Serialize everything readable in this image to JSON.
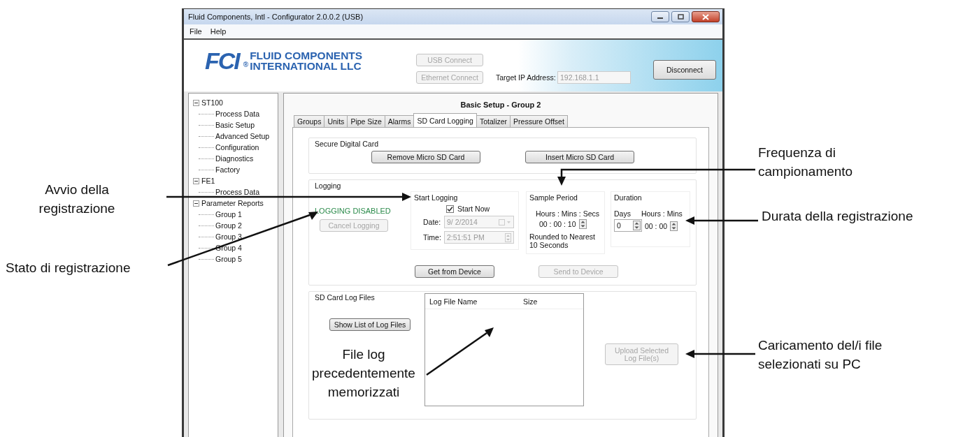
{
  "window": {
    "title": "Fluid Components, Intl - Configurator 2.0.0.2 (USB)"
  },
  "menu": [
    {
      "label": "File"
    },
    {
      "label": "Help"
    }
  ],
  "header": {
    "logo_mark": "FCI",
    "trademark": "®",
    "logo_line1": "FLUID COMPONENTS",
    "logo_line2": "INTERNATIONAL LLC",
    "usb_button": {
      "label": "USB Connect",
      "disabled": true
    },
    "ethernet_button": {
      "label": "Ethernet Connect",
      "disabled": true
    },
    "ip_label": "Target IP Address:",
    "ip_value": "192.168.1.1",
    "ip_disabled": true,
    "disconnect_button": {
      "label": "Disconnect",
      "disabled": false
    }
  },
  "sidebar": {
    "tree": [
      {
        "label": "ST100",
        "expanded": true,
        "children": [
          {
            "label": "Process Data"
          },
          {
            "label": "Basic Setup"
          },
          {
            "label": "Advanced Setup"
          },
          {
            "label": "Configuration"
          },
          {
            "label": "Diagnostics"
          },
          {
            "label": "Factory"
          }
        ]
      },
      {
        "label": "FE1",
        "expanded": true,
        "children": [
          {
            "label": "Process Data"
          }
        ]
      },
      {
        "label": "Parameter Reports",
        "expanded": true,
        "children": [
          {
            "label": "Group 1"
          },
          {
            "label": "Group 2"
          },
          {
            "label": "Group 3"
          },
          {
            "label": "Group 4"
          },
          {
            "label": "Group 5"
          }
        ]
      }
    ]
  },
  "main": {
    "title": "Basic Setup - Group 2",
    "tabs": [
      {
        "label": "Groups",
        "selected": false
      },
      {
        "label": "Units",
        "selected": false
      },
      {
        "label": "Pipe Size",
        "selected": false
      },
      {
        "label": "Alarms",
        "selected": false
      },
      {
        "label": "SD Card Logging",
        "selected": true
      },
      {
        "label": "Totalizer",
        "selected": false
      },
      {
        "label": "Pressure Offset",
        "selected": false
      }
    ],
    "secure_digital_card": {
      "title": "Secure Digital Card",
      "buttons": [
        {
          "label": "Remove Micro SD Card",
          "disabled": false
        },
        {
          "label": "Insert Micro SD Card",
          "disabled": false
        }
      ]
    },
    "logging": {
      "title": "Logging",
      "status": "LOGGING DISABLED",
      "cancel_button": {
        "label": "Cancel Logging",
        "disabled": true
      },
      "start_logging": {
        "title": "Start Logging",
        "start_now": {
          "label": "Start Now",
          "checked": true
        },
        "date_label": "Date:",
        "date_value": "9/ 2/2014",
        "time_label": "Time:",
        "time_value": "2:51:51 PM",
        "disabled": true
      },
      "sample_period": {
        "title": "Sample Period",
        "units": "Hours : Mins : Secs",
        "value": "00 : 00 : 10",
        "note": "Rounded to Nearest 10 Seconds"
      },
      "duration": {
        "title": "Duration",
        "days_label": "Days",
        "days_value": "0",
        "hours_label": "Hours : Mins",
        "hours_value": "00 : 00"
      },
      "device_buttons": [
        {
          "label": "Get from Device",
          "disabled": false
        },
        {
          "label": "Send to Device",
          "disabled": true
        }
      ]
    },
    "log_files": {
      "title": "SD Card Log Files",
      "show_button": {
        "label": "Show List of Log Files",
        "disabled": false
      },
      "columns": [
        "Log File Name",
        "Size"
      ],
      "upload_button": {
        "label": "Upload Selected Log File(s)",
        "disabled": true
      }
    }
  },
  "callouts": [
    {
      "text": "Avvio della registrazione"
    },
    {
      "text": "Stato di registrazione"
    },
    {
      "text": "Frequenza di campionamento"
    },
    {
      "text": "Durata della registrazione"
    },
    {
      "text": "File log precedentemente memorizzati"
    },
    {
      "text": "Caricamento del/i file selezionati su PC"
    }
  ]
}
